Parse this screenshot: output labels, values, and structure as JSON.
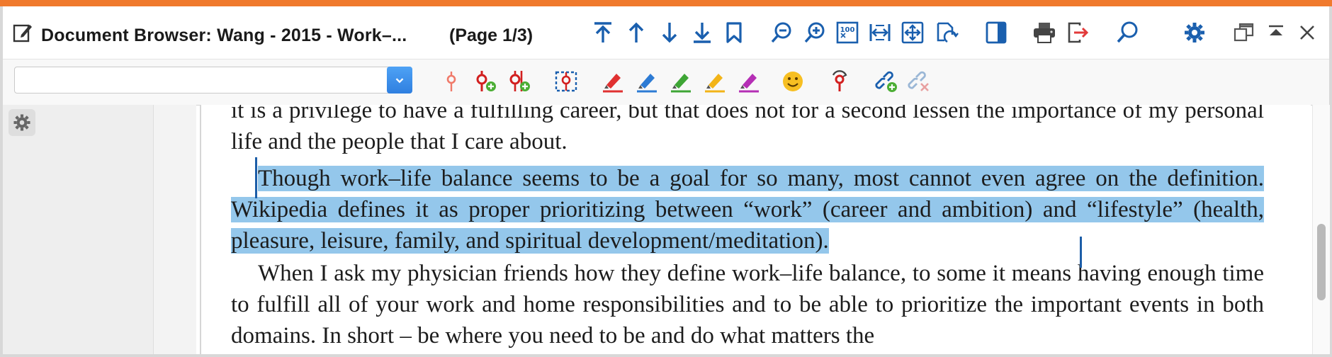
{
  "window": {
    "title": "Document Browser: Wang - 2015 - Work–...",
    "page_indicator": "(Page 1/3)",
    "accent_color": "#f07a2d"
  },
  "toolbar_icons": [
    "first-page-icon",
    "previous-page-icon",
    "next-page-icon",
    "last-page-icon",
    "bookmark-icon",
    "zoom-out-icon",
    "zoom-in-icon",
    "zoom-100-icon",
    "fit-width-icon",
    "fit-page-icon",
    "rotate-page-icon",
    "sidebar-toggle-icon",
    "print-icon",
    "export-icon",
    "search-icon",
    "settings-gear-icon",
    "undock-window-icon",
    "collapse-icon",
    "close-icon"
  ],
  "code_toolbar": {
    "search_value": "",
    "icons": [
      "code-pin-icon",
      "code-pin-add-icon",
      "code-multi-add-icon",
      "select-region-icon",
      "red-highlighter-icon",
      "blue-highlighter-icon",
      "green-highlighter-icon",
      "yellow-highlighter-icon",
      "purple-highlighter-icon",
      "emoji-icon",
      "recent-code-icon",
      "link-add-icon",
      "link-remove-icon"
    ]
  },
  "document": {
    "para1": "it is a privilege to have a fulfilling career, but that does not for a second lessen the importance of my personal life and the people that I care about.",
    "para2_selected": "Though work–life balance seems to be a goal for so many, most cannot even agree on the definition. Wikipedia defines it as proper prioritizing between “work” (career and ambition) and “lifestyle” (health, pleasure, leisure, family, and spiritual development/meditation).",
    "para3": "When I ask my physician friends how they define work–life balance, to some it means having enough time to fulfill all of your work and home responsibilities and to be able to prioritize the important events in both domains. In short – be where you need to be and do what matters the",
    "highlight_color": "#94c7eb"
  }
}
